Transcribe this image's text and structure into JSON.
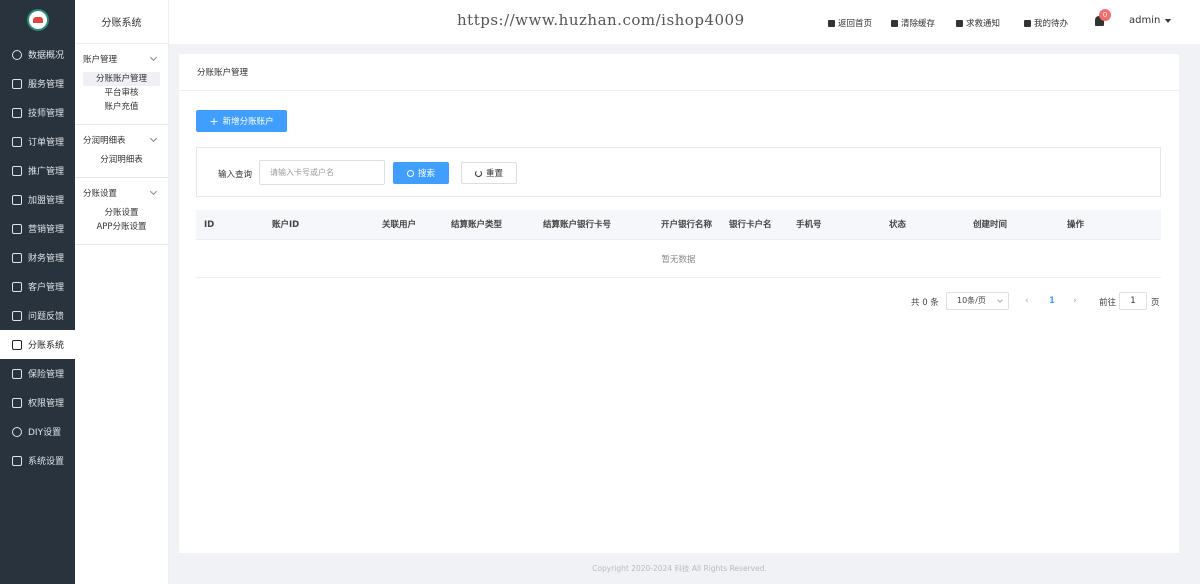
{
  "nav": {
    "items": [
      {
        "label": "数据概况",
        "icon": "clock-icon"
      },
      {
        "label": "服务管理",
        "icon": "service-icon"
      },
      {
        "label": "技师管理",
        "icon": "technician-icon"
      },
      {
        "label": "订单管理",
        "icon": "order-icon"
      },
      {
        "label": "推广管理",
        "icon": "promotion-icon"
      },
      {
        "label": "加盟管理",
        "icon": "franchise-icon"
      },
      {
        "label": "营销管理",
        "icon": "marketing-icon"
      },
      {
        "label": "财务管理",
        "icon": "finance-icon"
      },
      {
        "label": "客户管理",
        "icon": "customer-icon"
      },
      {
        "label": "问题反馈",
        "icon": "feedback-icon"
      },
      {
        "label": "分账系统",
        "icon": "split-account-icon",
        "active": true
      },
      {
        "label": "保险管理",
        "icon": "shield-icon"
      },
      {
        "label": "权限管理",
        "icon": "permission-icon"
      },
      {
        "label": "DIY设置",
        "icon": "diy-icon"
      },
      {
        "label": "系统设置",
        "icon": "gear-icon"
      }
    ]
  },
  "subnav": {
    "title": "分账系统",
    "groups": [
      {
        "label": "账户管理",
        "items": [
          "分账账户管理",
          "平台审核",
          "账户充值"
        ]
      },
      {
        "label": "分润明细表",
        "items": [
          "分润明细表"
        ]
      },
      {
        "label": "分账设置",
        "items": [
          "分账设置",
          "APP分账设置"
        ]
      }
    ]
  },
  "header": {
    "watermark": "https://www.huzhan.com/ishop4009",
    "links": [
      "返回首页",
      "清除缓存",
      "求救通知",
      "我的待办"
    ],
    "badge": "0",
    "user": "admin"
  },
  "page": {
    "breadcrumb": "分账账户管理",
    "add_button": "新增分账账户",
    "search_label": "输入查询",
    "search_placeholder": "请输入卡号或户名",
    "search_button": "搜索",
    "reset_button": "重置",
    "columns": [
      "ID",
      "账户ID",
      "关联用户",
      "结算账户类型",
      "结算账户银行卡号",
      "开户银行名称",
      "银行卡户名",
      "手机号",
      "状态",
      "创建时间",
      "操作"
    ],
    "empty_text": "暂无数据"
  },
  "pagination": {
    "total": "共 0 条",
    "page_size": "10条/页",
    "current": "1",
    "goto_label": "前往",
    "goto_value": "1",
    "unit": "页"
  },
  "footer": "Copyright 2020-2024 科技 All Rights Reserved."
}
